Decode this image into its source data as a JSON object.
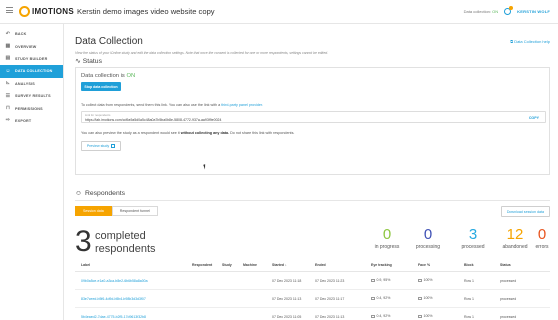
{
  "header": {
    "brand": "IMOTIONS",
    "study_title": "Kerstin demo images video website copy",
    "data_collection_label": "Data collection:",
    "data_collection_state": "ON",
    "user": "KERSTIN WOLF"
  },
  "sidebar": {
    "items": [
      {
        "label": "BACK",
        "icon": "undo-icon"
      },
      {
        "label": "OVERVIEW",
        "icon": "grid-icon"
      },
      {
        "label": "STUDY BUILDER",
        "icon": "builder-icon"
      },
      {
        "label": "DATA COLLECTION",
        "icon": "people-icon"
      },
      {
        "label": "ANALYSIS",
        "icon": "chart-icon"
      },
      {
        "label": "SURVEY RESULTS",
        "icon": "list-icon"
      },
      {
        "label": "PERMISSIONS",
        "icon": "lock-icon"
      },
      {
        "label": "EXPORT",
        "icon": "export-icon"
      }
    ],
    "active_index": 3
  },
  "page": {
    "title": "Data Collection",
    "help_link": "Data Collection help",
    "description": "View the status of your iOnline study and edit the data collection settings. Note that once the consent is collected for one or more respondents, settings cannot be edited.",
    "status_heading": "Status"
  },
  "status": {
    "text_prefix": "Data collection is",
    "text_state": "ON",
    "stop_button": "Stop data collection",
    "collect_text_prefix": "To collect data from respondents, send them this link. You can also use the link with a",
    "collect_text_link": "third-party panel provider.",
    "link_caption": "Link for respondents",
    "link_url": "https://lab.imotions.com/cd9a9a5d0a5c48a0a7b5ba0b8e-5808-4772-937a-aa93f9e0024",
    "copy_label": "COPY",
    "preview_prefix": "You can also preview the study as a respondent would see it",
    "preview_bold": "without collecting any data.",
    "preview_suffix": "Do not share this link with respondents.",
    "preview_button": "Preview study"
  },
  "respondents": {
    "heading": "Respondents",
    "tabs": [
      "Session data",
      "Respondent funnel"
    ],
    "active_tab": 0,
    "download_button": "Download session data",
    "completed_count": "3",
    "completed_label_1": "completed",
    "completed_label_2": "respondents",
    "stats": [
      {
        "value": "0",
        "label": "in progress",
        "color": "#8dc63f"
      },
      {
        "value": "0",
        "label": "processing",
        "color": "#3f51b5"
      },
      {
        "value": "3",
        "label": "processed",
        "color": "#26a9e0"
      },
      {
        "value": "12",
        "label": "abandoned",
        "color": "#f6a400"
      },
      {
        "value": "0",
        "label": "errors",
        "color": "#e8541e"
      }
    ]
  },
  "table": {
    "columns": [
      "Label",
      "Respondent",
      "Study",
      "Machine",
      "Started ↓",
      "Ended",
      "Eye tracking",
      "Face %",
      "Block",
      "Status"
    ],
    "rows": [
      [
        "09b0a5ce-e1a0-a3ca-b8e2-6b6b58a8a00a",
        "",
        "",
        "",
        "07 Dec 2023 11:18",
        "07 Dec 2023 11:23",
        "0.9, 95%",
        "100%",
        "Row 1",
        "processed"
      ],
      [
        "83e7ceed-b5f6-4d9d-b5b4-b98b3d3d3f07",
        "",
        "",
        "",
        "07 Dec 2023 11:13",
        "07 Dec 2023 11:17",
        "0.4, 92%",
        "100%",
        "Row 1",
        "processed"
      ],
      [
        "5b4eaed2-7dae-4775-b2f5-17d9613f32b8",
        "",
        "",
        "",
        "07 Dec 2023 11:05",
        "07 Dec 2023 11:13",
        "0.4, 92%",
        "100%",
        "Row 1",
        "processed"
      ]
    ]
  }
}
